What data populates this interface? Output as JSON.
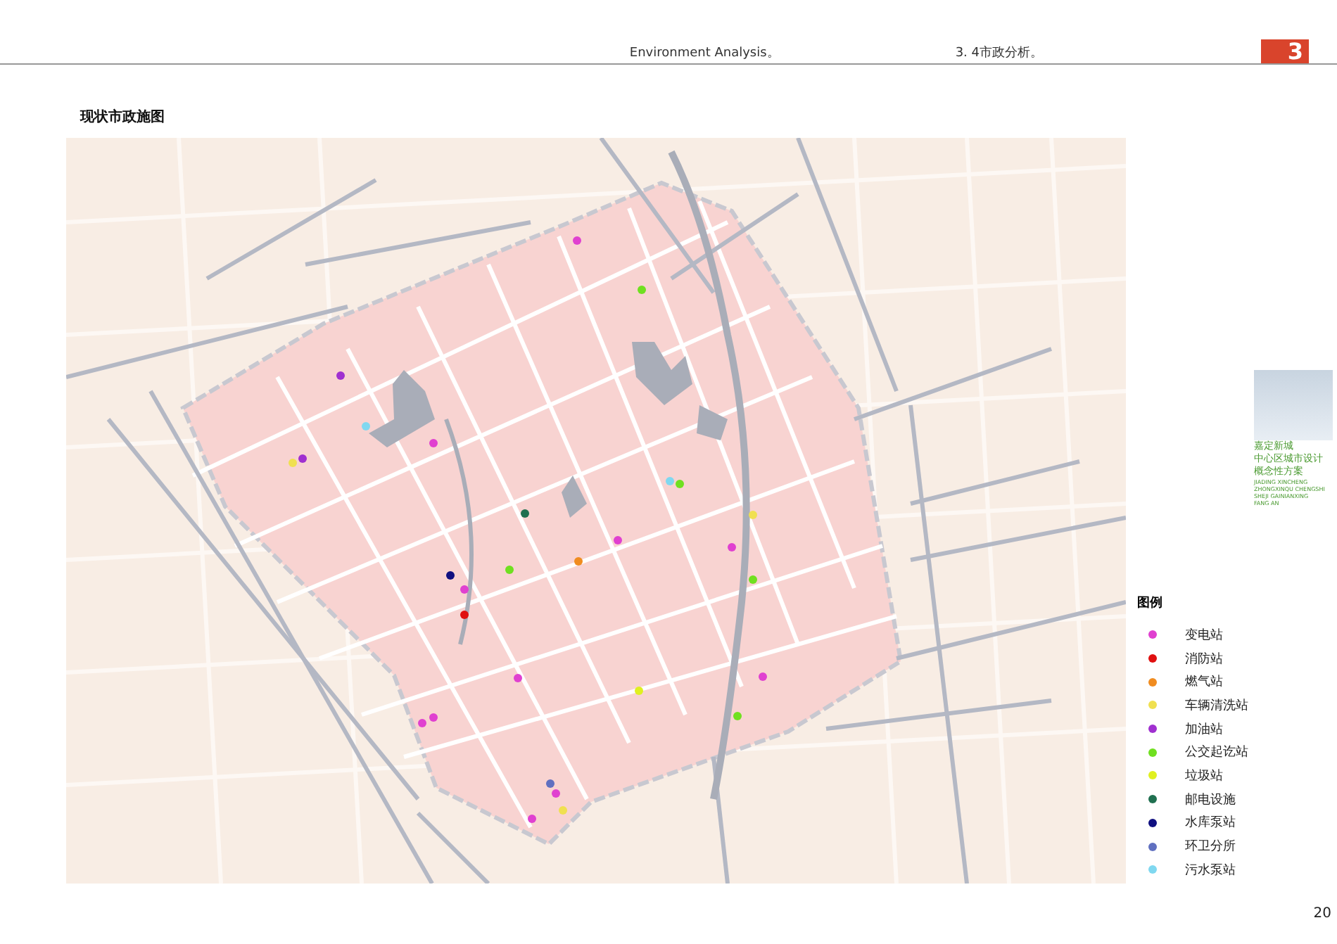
{
  "header": {
    "section_en": "Environment Analysis。",
    "section_cn": "3. 4市政分析。",
    "chapter": "3"
  },
  "map": {
    "title": "现状市政施图"
  },
  "project": {
    "name_lines": [
      "嘉定新城",
      "中心区城市设计",
      "概念性方案"
    ],
    "pinyin_lines": [
      "JIADING XINCHENG",
      "ZHONGXINQU CHENGSHI",
      "SHEJI GAINIANXING",
      "FANG AN"
    ]
  },
  "legend": {
    "title": "图例",
    "items": [
      {
        "label": "变电站",
        "color": "#e040d0"
      },
      {
        "label": "消防站",
        "color": "#e01010"
      },
      {
        "label": "燃气站",
        "color": "#f08c20"
      },
      {
        "label": "车辆清洗站",
        "color": "#f0e050"
      },
      {
        "label": "加油站",
        "color": "#a030d0"
      },
      {
        "label": "公交起讫站",
        "color": "#70e020"
      },
      {
        "label": "垃圾站",
        "color": "#e0f020"
      },
      {
        "label": "邮电设施",
        "color": "#207050"
      },
      {
        "label": "水库泵站",
        "color": "#101080"
      },
      {
        "label": "环卫分所",
        "color": "#6070c0"
      },
      {
        "label": "污水泵站",
        "color": "#80d8f0"
      }
    ]
  },
  "page_number": "20"
}
